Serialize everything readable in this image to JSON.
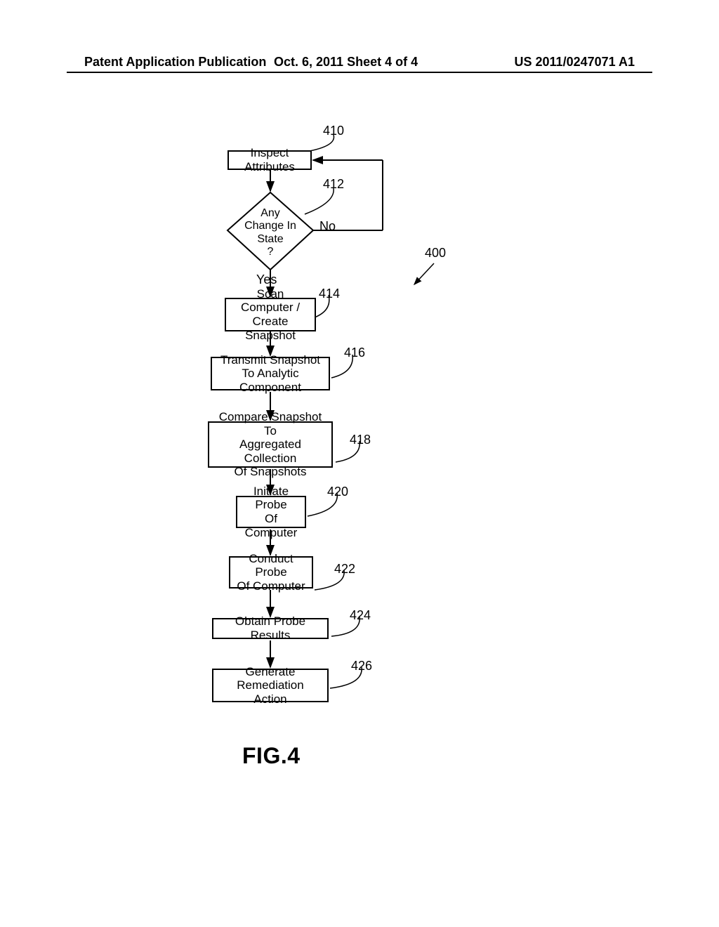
{
  "header": {
    "left": "Patent Application Publication",
    "mid": "Oct. 6, 2011   Sheet 4 of 4",
    "right": "US 2011/0247071 A1"
  },
  "figure_label": "FIG.4",
  "ref_overall": "400",
  "steps": {
    "s410": {
      "num": "410",
      "text": "Inspect Attributes"
    },
    "s412": {
      "num": "412",
      "text": "Any\nChange In\nState\n?",
      "yes": "Yes",
      "no": "No"
    },
    "s414": {
      "num": "414",
      "text": "Scan Computer /\nCreate Snapshot"
    },
    "s416": {
      "num": "416",
      "text": "Transmit Snapshot\nTo Analytic Component"
    },
    "s418": {
      "num": "418",
      "text": "Compare Snapshot To\nAggregated Collection\nOf Snapshots"
    },
    "s420": {
      "num": "420",
      "text": "Initiate Probe\nOf Computer"
    },
    "s422": {
      "num": "422",
      "text": "Conduct Probe\nOf Computer"
    },
    "s424": {
      "num": "424",
      "text": "Obtain Probe Results"
    },
    "s426": {
      "num": "426",
      "text": "Generate Remediation\nAction"
    }
  }
}
